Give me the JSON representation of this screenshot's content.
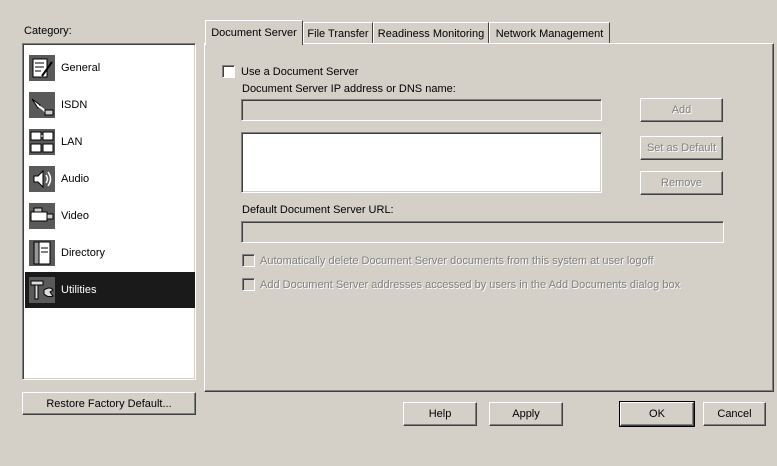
{
  "category": {
    "label": "Category:",
    "items": [
      {
        "label": "General",
        "icon": "general-icon"
      },
      {
        "label": "ISDN",
        "icon": "isdn-icon"
      },
      {
        "label": "LAN",
        "icon": "lan-icon"
      },
      {
        "label": "Audio",
        "icon": "audio-icon"
      },
      {
        "label": "Video",
        "icon": "video-icon"
      },
      {
        "label": "Directory",
        "icon": "directory-icon"
      },
      {
        "label": "Utilities",
        "icon": "utilities-icon"
      }
    ],
    "selected": "Utilities"
  },
  "restore_button": "Restore Factory Default...",
  "tabs": [
    {
      "label": "Document Server"
    },
    {
      "label": "File Transfer"
    },
    {
      "label": "Readiness Monitoring"
    },
    {
      "label": "Network Management"
    }
  ],
  "active_tab": "Document Server",
  "doc_server": {
    "use_checkbox_label": "Use a Document Server",
    "ip_label": "Document Server IP address or DNS name:",
    "ip_value": "",
    "add_button": "Add",
    "set_default_button": "Set as Default",
    "remove_button": "Remove",
    "url_label": "Default Document Server URL:",
    "url_value": "",
    "auto_delete_label": "Automatically delete Document Server documents from this system at user logoff",
    "add_addresses_label": "Add Document Server addresses accessed by users in the Add Documents dialog box"
  },
  "footer": {
    "help": "Help",
    "apply": "Apply",
    "ok": "OK",
    "cancel": "Cancel"
  },
  "colors": {
    "dialog_bg": "#d4d0c8",
    "selection_bg": "#1a1a1a",
    "disabled_text": "#808080"
  }
}
